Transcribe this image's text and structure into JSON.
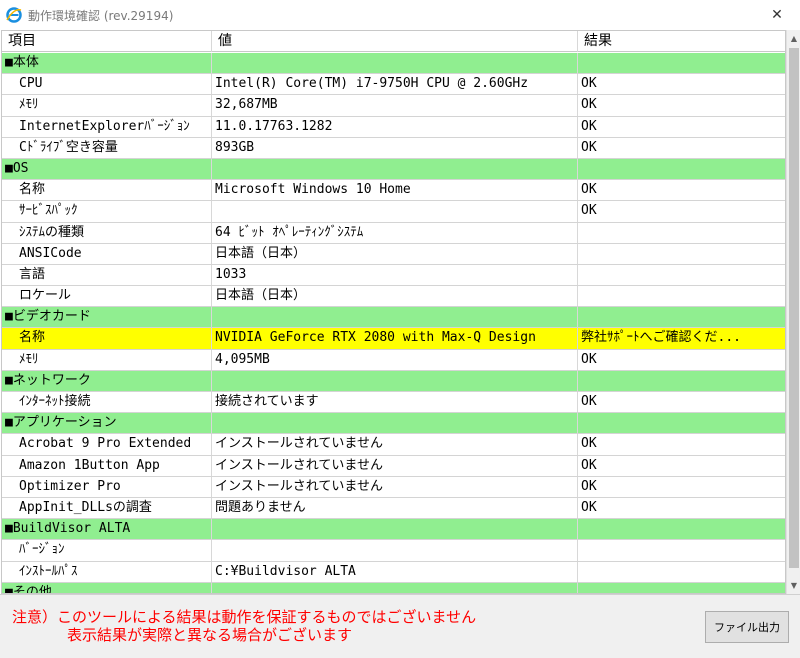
{
  "window": {
    "title": "動作環境確認 (rev.29194)",
    "close_label": "✕"
  },
  "grid": {
    "columns": [
      "項目",
      "値",
      "結果"
    ],
    "rows": [
      {
        "type": "section",
        "item": "■本体",
        "value": "",
        "result": ""
      },
      {
        "type": "normal",
        "item": "CPU",
        "value": "Intel(R) Core(TM) i7-9750H CPU @ 2.60GHz",
        "result": "OK"
      },
      {
        "type": "normal",
        "item": "ﾒﾓﾘ",
        "value": "32,687MB",
        "result": "OK"
      },
      {
        "type": "normal",
        "item": "InternetExplorerﾊﾞｰｼﾞｮﾝ",
        "value": "11.0.17763.1282",
        "result": "OK"
      },
      {
        "type": "normal",
        "item": "Cﾄﾞﾗｲﾌﾞ空き容量",
        "value": "893GB",
        "result": "OK"
      },
      {
        "type": "section",
        "item": "■OS",
        "value": "",
        "result": ""
      },
      {
        "type": "normal",
        "item": "名称",
        "value": "Microsoft Windows 10 Home",
        "result": "OK"
      },
      {
        "type": "normal",
        "item": "ｻｰﾋﾞｽﾊﾟｯｸ",
        "value": "",
        "result": "OK"
      },
      {
        "type": "normal",
        "item": "ｼｽﾃﾑの種類",
        "value": "64 ﾋﾞｯﾄ ｵﾍﾟﾚｰﾃｨﾝｸﾞｼｽﾃﾑ",
        "result": ""
      },
      {
        "type": "normal",
        "item": "ANSICode",
        "value": "日本語（日本）",
        "result": ""
      },
      {
        "type": "normal",
        "item": "言語",
        "value": "1033",
        "result": ""
      },
      {
        "type": "normal",
        "item": "ロケール",
        "value": "日本語（日本）",
        "result": ""
      },
      {
        "type": "section",
        "item": "■ビデオカード",
        "value": "",
        "result": ""
      },
      {
        "type": "warn",
        "item": "名称",
        "value": "NVIDIA GeForce RTX 2080 with Max-Q Design",
        "result": "弊社ｻﾎﾟｰﾄへご確認くだ..."
      },
      {
        "type": "normal",
        "item": "ﾒﾓﾘ",
        "value": "4,095MB",
        "result": "OK"
      },
      {
        "type": "section",
        "item": "■ネットワーク",
        "value": "",
        "result": ""
      },
      {
        "type": "normal",
        "item": "ｲﾝﾀｰﾈｯﾄ接続",
        "value": "接続されています",
        "result": "OK"
      },
      {
        "type": "section",
        "item": "■アプリケーション",
        "value": "",
        "result": ""
      },
      {
        "type": "normal",
        "item": "Acrobat 9 Pro Extended",
        "value": "インストールされていません",
        "result": "OK"
      },
      {
        "type": "normal",
        "item": "Amazon 1Button App",
        "value": "インストールされていません",
        "result": "OK"
      },
      {
        "type": "normal",
        "item": "Optimizer Pro",
        "value": "インストールされていません",
        "result": "OK"
      },
      {
        "type": "normal",
        "item": "AppInit_DLLsの調査",
        "value": "問題ありません",
        "result": "OK"
      },
      {
        "type": "section",
        "item": "■BuildVisor ALTA",
        "value": "",
        "result": ""
      },
      {
        "type": "normal",
        "item": "ﾊﾞｰｼﾞｮﾝ",
        "value": "",
        "result": ""
      },
      {
        "type": "normal",
        "item": "ｲﾝｽﾄｰﾙﾊﾟｽ",
        "value": "C:¥Buildvisor ALTA",
        "result": ""
      },
      {
        "type": "section",
        "item": "■その他",
        "value": "",
        "result": ""
      }
    ]
  },
  "footer": {
    "notice_line1": "注意）このツールによる結果は動作を保証するものではございません",
    "notice_line2": "表示結果が実際と異なる場合がございます",
    "export_button": "ファイル出力"
  },
  "colors": {
    "section_row": "#90ee90",
    "warning_row": "#ffff00",
    "notice_text": "#ff0000"
  }
}
